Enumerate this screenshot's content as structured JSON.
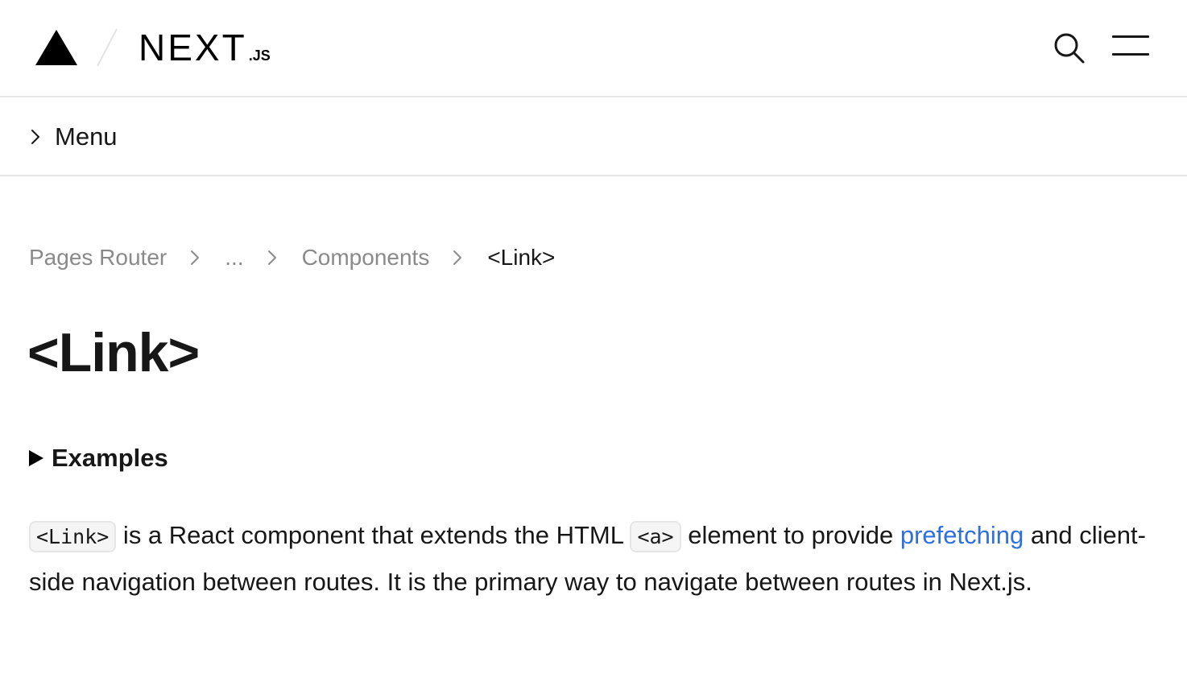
{
  "header": {
    "logo_word": "NEXT",
    "logo_suffix": ".JS"
  },
  "menu": {
    "label": "Menu"
  },
  "breadcrumb": {
    "items": [
      "Pages Router",
      "...",
      "Components",
      "<Link>"
    ]
  },
  "page": {
    "title": "<Link>",
    "examples_label": "Examples"
  },
  "intro": {
    "code_link": "<Link>",
    "text_1": " is a React component that extends the HTML ",
    "code_a": "<a>",
    "text_2": " element to provide ",
    "link_prefetching": "prefetching",
    "text_3": " and client-side navigation between routes. It is the primary way to navigate between routes in Next.js."
  },
  "colors": {
    "text": "#171717",
    "muted": "#8a8a8a",
    "link": "#2f6fe0",
    "border": "#e8e8e8",
    "code_bg": "#f5f5f5"
  }
}
